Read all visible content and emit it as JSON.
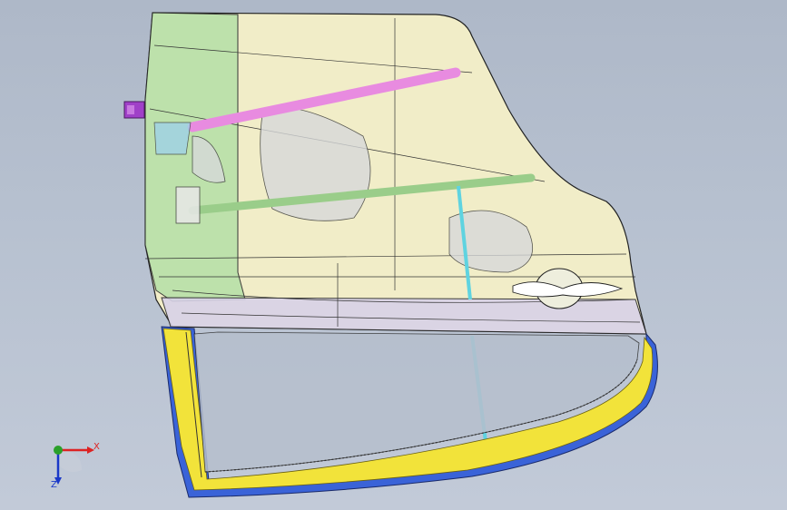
{
  "viewport": {
    "background_top": "#aeb8c8",
    "background_bottom": "#c2cad8"
  },
  "model": {
    "panel_fill": "#f5f0c8",
    "panel_front_fill": "#b8e0a8",
    "lower_strip_fill": "#d8d2e8",
    "edge_color": "#1a1a1a",
    "beam_upper_color": "#e88be0",
    "beam_lower_color": "#9acd8a",
    "channel_color": "#5fd3e0",
    "frame_yellow": "#f2e33a",
    "frame_blue": "#3a63d8",
    "hinge_color": "#a040c8"
  },
  "triad": {
    "x_label": "X",
    "z_label": "Z",
    "icons": [
      "axis-x-icon",
      "axis-y-icon",
      "axis-z-icon"
    ]
  }
}
